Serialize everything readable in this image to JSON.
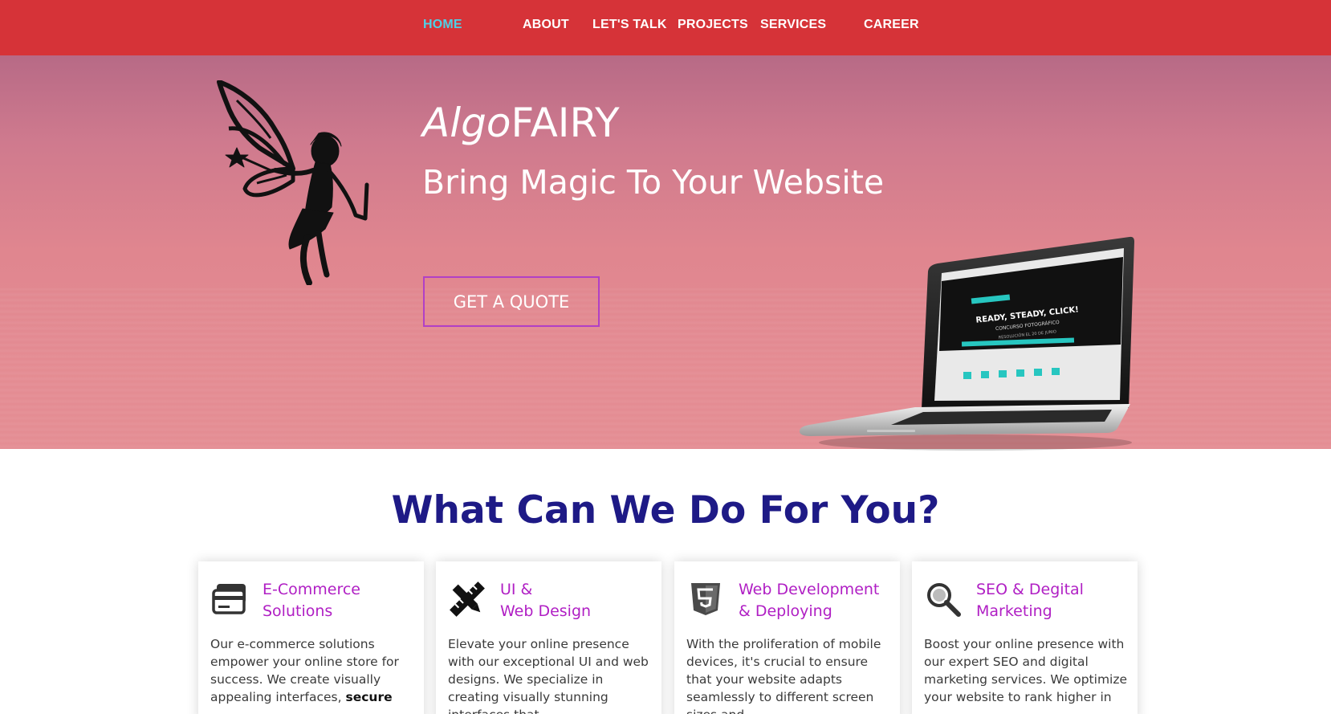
{
  "nav": {
    "items": [
      {
        "label": "HOME",
        "active": true
      },
      {
        "label": "ABOUT"
      },
      {
        "label": "LET'S TALK"
      },
      {
        "label": "PROJECTS"
      },
      {
        "label": "SERVICES"
      },
      {
        "label": "CAREER"
      }
    ]
  },
  "hero": {
    "brand_italic": "Algo",
    "brand_regular": "FAIRY",
    "tagline": "Bring Magic To Your Website",
    "cta": "GET A QUOTE",
    "laptop_screen": {
      "headline": "READY, STEADY, CLICK!",
      "sub": "CONCURSO FOTOGRÁFICO",
      "note": "RESOLUCIÓN EL 20 DE JUNIO"
    }
  },
  "services": {
    "title": "What Can We Do For You?",
    "cards": [
      {
        "title_line1": "E-Commerce",
        "title_line2": "Solutions",
        "icon": "credit-card-icon",
        "text": "Our e-commerce solutions empower your online store for success. We create visually appealing interfaces,",
        "text_bold": "secure"
      },
      {
        "title_line1": "UI &",
        "title_line2": "Web Design",
        "icon": "pencil-ruler-icon",
        "text": "Elevate your online presence with our exceptional UI and web designs. We specialize in creating visually stunning interfaces that",
        "text_bold": ""
      },
      {
        "title_line1": "Web Development",
        "title_line2": "& Deploying",
        "icon": "html5-icon",
        "text": "With the proliferation of mobile devices, it's crucial to ensure that your website adapts seamlessly to different screen sizes and",
        "text_bold": ""
      },
      {
        "title_line1": "SEO & Degital",
        "title_line2": "Marketing",
        "icon": "seo-search-icon",
        "text": "Boost your online presence with our expert SEO and digital marketing services. We optimize your website to rank higher in",
        "text_bold": ""
      }
    ]
  },
  "colors": {
    "nav_bg": "#d63338",
    "nav_active": "#4fd0e6",
    "hero_bg": "#e0868f",
    "cta_border": "#b140c6",
    "section_title": "#1e1a86",
    "card_title": "#b01fc4"
  }
}
